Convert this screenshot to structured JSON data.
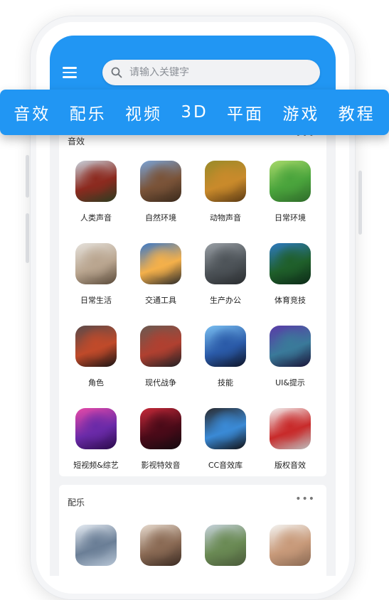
{
  "search": {
    "placeholder": "请输入关键字"
  },
  "categories": [
    "音效",
    "配乐",
    "视频",
    "3D",
    "平面",
    "游戏",
    "教程"
  ],
  "sections": [
    {
      "title": "音效",
      "items": [
        {
          "label": "人类声音",
          "icon": "crowd-photo-icon",
          "colors": [
            "#c9d3dd",
            "#8c2a1f",
            "#2c3c20"
          ]
        },
        {
          "label": "自然环境",
          "icon": "mountain-photo-icon",
          "colors": [
            "#7aa3d6",
            "#7a5338",
            "#3a2a1c"
          ]
        },
        {
          "label": "动物声音",
          "icon": "lion-photo-icon",
          "colors": [
            "#9a8b2a",
            "#c98a2b",
            "#5b3a14"
          ]
        },
        {
          "label": "日常环境",
          "icon": "tennis-ball-icon",
          "colors": [
            "#a8d96a",
            "#4aa43c",
            "#2f6b2a"
          ]
        },
        {
          "label": "日常生活",
          "icon": "faucet-photo-icon",
          "colors": [
            "#e6e2dc",
            "#b9a58f",
            "#5a4a3a"
          ]
        },
        {
          "label": "交通工具",
          "icon": "airplane-photo-icon",
          "colors": [
            "#3a78c9",
            "#f4b04a",
            "#2a2a2a"
          ]
        },
        {
          "label": "生产办公",
          "icon": "office-photo-icon",
          "colors": [
            "#9aa0a6",
            "#4d5358",
            "#2a2d30"
          ]
        },
        {
          "label": "体育竞技",
          "icon": "football-photo-icon",
          "colors": [
            "#2e7ac2",
            "#1f5f2a",
            "#0d2a18"
          ]
        },
        {
          "label": "角色",
          "icon": "character-art-icon",
          "colors": [
            "#5a4a4a",
            "#c04a2a",
            "#1a1414"
          ]
        },
        {
          "label": "现代战争",
          "icon": "soldiers-art-icon",
          "colors": [
            "#6a5a52",
            "#b04030",
            "#202024"
          ]
        },
        {
          "label": "技能",
          "icon": "skill-effect-icon",
          "colors": [
            "#7ac0f2",
            "#2a5aa8",
            "#0e1428"
          ]
        },
        {
          "label": "UI&提示",
          "icon": "game-ui-icon",
          "colors": [
            "#5a3aa8",
            "#3a7a9a",
            "#1a1438"
          ]
        },
        {
          "label": "短视频&综艺",
          "icon": "short-video-icon",
          "colors": [
            "#e84aa8",
            "#6a2aa8",
            "#2a0a4a"
          ]
        },
        {
          "label": "影视特效音",
          "icon": "film-effect-icon",
          "colors": [
            "#c82a3a",
            "#4a0a18",
            "#140a10"
          ]
        },
        {
          "label": "CC音效库",
          "icon": "cc-library-icon",
          "colors": [
            "#2a2a2e",
            "#3a8ad6",
            "#111114"
          ]
        },
        {
          "label": "版权音效",
          "icon": "copyright-keyboard-icon",
          "colors": [
            "#f2f2f2",
            "#c82a2a",
            "#bdbdbd"
          ]
        }
      ]
    },
    {
      "title": "配乐",
      "items": [
        {
          "label": "",
          "icon": "snow-mountain-icon",
          "colors": [
            "#e8eef5",
            "#6a7e96",
            "#b8c6d6"
          ]
        },
        {
          "label": "",
          "icon": "people-photo-icon",
          "colors": [
            "#e8dcd0",
            "#8a6a54",
            "#3a2a22"
          ]
        },
        {
          "label": "",
          "icon": "village-photo-icon",
          "colors": [
            "#c8d4de",
            "#6a8a54",
            "#4a5a3a"
          ]
        },
        {
          "label": "",
          "icon": "thumbs-up-icon",
          "colors": [
            "#f4f4f2",
            "#c89a7a",
            "#8a6a54"
          ]
        }
      ]
    }
  ]
}
